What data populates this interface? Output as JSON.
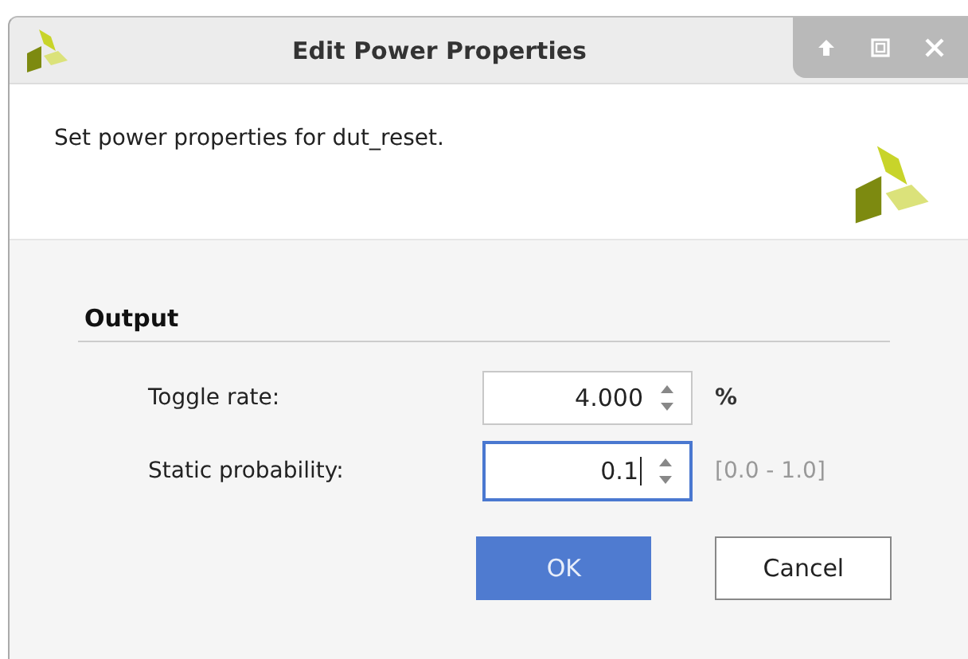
{
  "window": {
    "title": "Edit Power Properties"
  },
  "header": {
    "message": "Set power properties for dut_reset."
  },
  "section": {
    "title": "Output"
  },
  "fields": [
    {
      "label": "Toggle rate:",
      "value": "4.000",
      "focused": false,
      "suffix": "%",
      "kind": "unit"
    },
    {
      "label": "Static probability:",
      "value": "0.1",
      "focused": true,
      "suffix": "[0.0 - 1.0]",
      "kind": "hint"
    }
  ],
  "buttons": [
    {
      "label": "OK",
      "kind": "primary"
    },
    {
      "label": "Cancel",
      "kind": "secondary"
    }
  ]
}
